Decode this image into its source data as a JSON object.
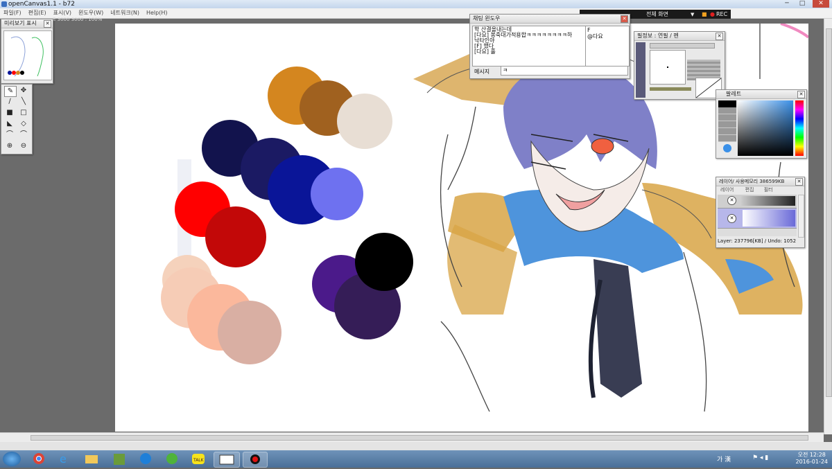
{
  "window": {
    "title": "openCanvas1.1 - b72",
    "min": "─",
    "max": "□",
    "close": "✕"
  },
  "menu": [
    "파일(F)",
    "편집(E)",
    "표시(V)",
    "윈도우(W)",
    "네트워크(N)",
    "Help(H)"
  ],
  "canvas_info": "E  3000  3000 : 100%",
  "fullscreen": {
    "label": "전체 화면",
    "rec": "REC"
  },
  "preview": {
    "title": "미리보기 표시"
  },
  "chat": {
    "title": "채팅 윈도우",
    "log": [
      "학 산결올내는데",
      "[다요] 봉죽대가적용합ㅋㅋㅋㅋㅋㅋㅋㅋ하",
      "낙타인야",
      "[F] 했다",
      "[다요] 홀"
    ],
    "users": [
      "F",
      "@다요"
    ],
    "message_label": "메시지",
    "message_value": "ㅋ"
  },
  "brush": {
    "title": "필정보 : 연필 / 펜"
  },
  "palette": {
    "title": "팔레트"
  },
  "layer": {
    "title": "레이어/ 사용메모리 386599KB",
    "menu": [
      "레이어",
      "편집",
      "필터"
    ],
    "status": "Layer: 237796[KB] / Undo: 1052"
  },
  "taskbar": {
    "lang": "가 漢",
    "time": "오전 12:28",
    "date": "2016-01-24",
    "icons": [
      "start",
      "chrome",
      "ie",
      "explorer",
      "minecraft",
      "app-blue",
      "utorrent",
      "kakaotalk",
      "opencanvas",
      "recorder"
    ]
  },
  "colors": {
    "swatches": [
      "#d4861f",
      "#a0611f",
      "#e8ded4",
      "#12134d",
      "#1b1a63",
      "#0a1598",
      "#6e71f0",
      "#ff0000",
      "#c20808",
      "#f5d2bc",
      "#f6ccb6",
      "#fbb89c",
      "#d9afa3",
      "#4b1a8a",
      "#351d57",
      "#000000"
    ]
  }
}
